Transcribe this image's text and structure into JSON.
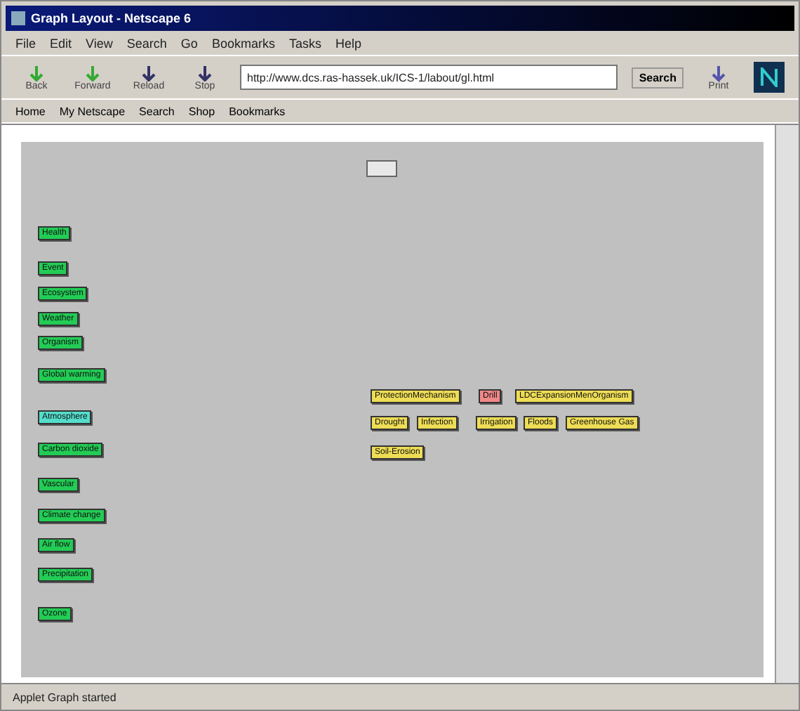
{
  "window": {
    "title": "Graph Layout - Netscape 6"
  },
  "menu": [
    "File",
    "Edit",
    "View",
    "Search",
    "Go",
    "Bookmarks",
    "Tasks",
    "Help"
  ],
  "nav_buttons": [
    "Back",
    "Forward",
    "Reload",
    "Stop"
  ],
  "address": {
    "value": "http://www.dcs.ras-hassek.uk/ICS-1/labout/gl.html"
  },
  "search_button": "Search",
  "print_button": "Print",
  "personal_toolbar": [
    "Home",
    "My Netscape",
    "Search",
    "Shop",
    "Bookmarks"
  ],
  "graph_nodes": [
    {
      "label": "Health",
      "color": "#22cc55"
    },
    {
      "label": "Event",
      "color": "#22cc55"
    },
    {
      "label": "Ecosystem",
      "color": "#22cc55"
    },
    {
      "label": "Weather",
      "color": "#22cc55"
    },
    {
      "label": "Organism",
      "color": "#22cc55"
    },
    {
      "label": "Global warming",
      "color": "#22cc55"
    },
    {
      "label": "Atmosphere",
      "color": "#55ddcc"
    },
    {
      "label": "Carbon dioxide",
      "color": "#22cc55"
    },
    {
      "label": "Vascular",
      "color": "#22cc55"
    },
    {
      "label": "Climate change",
      "color": "#22cc55"
    },
    {
      "label": "Air flow",
      "color": "#22cc55"
    },
    {
      "label": "Precipitation",
      "color": "#22cc55"
    },
    {
      "label": "Ozone",
      "color": "#22cc55"
    },
    {
      "label": "ProtectionMechanism",
      "color": "#eedd55"
    },
    {
      "label": "Drill",
      "color": "#f08888"
    },
    {
      "label": "LDCExpansionMenOrganism",
      "color": "#eedd55"
    },
    {
      "label": "Drought",
      "color": "#eedd55"
    },
    {
      "label": "Infection",
      "color": "#eedd55"
    },
    {
      "label": "Irrigation",
      "color": "#eedd55"
    },
    {
      "label": "Floods",
      "color": "#eedd55"
    },
    {
      "label": "Greenhouse Gas",
      "color": "#eedd55"
    },
    {
      "label": "Soil-Erosion",
      "color": "#eedd55"
    }
  ],
  "status_bar": {
    "text": "Applet Graph started"
  }
}
